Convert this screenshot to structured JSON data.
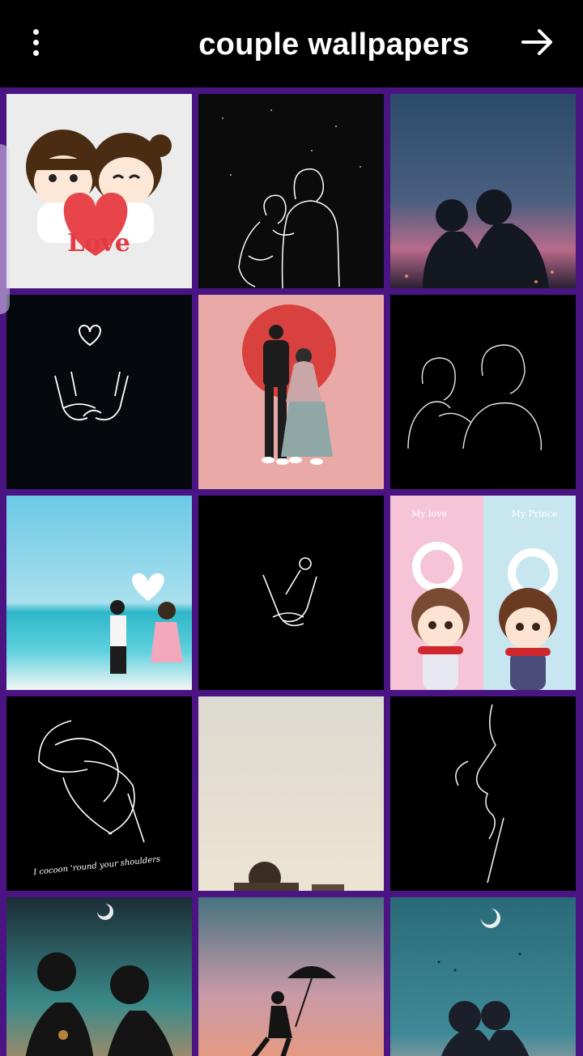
{
  "app": {
    "title": "couple wallpapers"
  },
  "toolbar": {
    "menu_icon": "more-vert-icon",
    "next_icon": "arrow-right-icon"
  },
  "colors": {
    "header_bg": "#000000",
    "grid_bg": "#4a1583",
    "title_color": "#ffffff"
  },
  "wallpapers": [
    {
      "name": "cartoon-couple-heart-love",
      "caption": "Love"
    },
    {
      "name": "line-art-couple-night"
    },
    {
      "name": "silhouette-couple-sunset"
    },
    {
      "name": "pinky-promise-heart"
    },
    {
      "name": "couple-pink-circle"
    },
    {
      "name": "line-art-couple-black"
    },
    {
      "name": "beach-couple-heart-cloud"
    },
    {
      "name": "holding-hands-rose"
    },
    {
      "name": "cartoon-couple-gender-symbols",
      "caption_left": "My love",
      "caption_right": "My Prince"
    },
    {
      "name": "hug-line-art",
      "caption": "I cocoon 'round your shoulders"
    },
    {
      "name": "man-reading-beige"
    },
    {
      "name": "face-line-art-black"
    },
    {
      "name": "silhouette-couple-moon"
    },
    {
      "name": "couple-umbrella-sunset"
    },
    {
      "name": "silhouette-couple-moon-teal"
    }
  ]
}
